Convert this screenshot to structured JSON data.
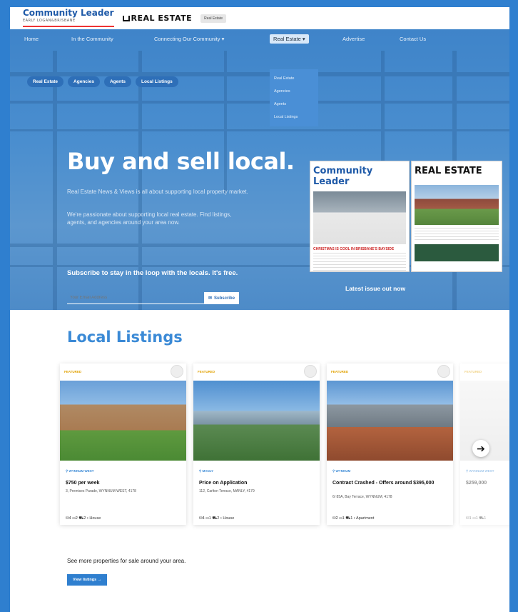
{
  "logos": {
    "community_leader": "Community Leader",
    "community_leader_sub": "EARLY LOGAN&BRISBANE",
    "real_estate": "REAL ESTATE",
    "pill": "Real Estate"
  },
  "nav": {
    "items": [
      "Home",
      "In the Community",
      "Connecting Our Community ▾",
      "Real Estate ▾",
      "Advertise",
      "Contact Us"
    ],
    "dropdown": [
      "Real Estate",
      "Agencies",
      "Agents",
      "Local Listings"
    ],
    "pills": [
      "Real Estate",
      "Agencies",
      "Agents",
      "Local Listings"
    ]
  },
  "hero": {
    "title": "Buy and sell local.",
    "para1": "Real Estate News & Views is all about supporting local property market.",
    "para2": "We're passionate about supporting local real estate. Find listings, agents, and agencies around your area now.",
    "subscribe_title": "Subscribe to stay in the loop with the locals. It's free.",
    "subscribe_placeholder": "Your Email Address",
    "subscribe_button": "Subscribe",
    "latest_issue": "Latest issue out now",
    "mag1_title": "Community Leader",
    "mag1_headline": "CHRISTMAS IS COOL IN BRISBANE'S BAYSIDE",
    "mag2_title": "REAL ESTATE"
  },
  "listings": {
    "title": "Local Listings",
    "cards": [
      {
        "tag": "FEATURED",
        "location": "WYNNUM WEST",
        "price": "$750 per week",
        "address": "3, Premises Parade, WYNNUM WEST, 4178",
        "features": "⛁4  ⛀2  ⛟2  •  House"
      },
      {
        "tag": "FEATURED",
        "location": "MANLY",
        "price": "Price on Application",
        "address": "112, Carlton Terrace, MANLY, 4179",
        "features": "⛁4  ⛀1  ⛟2  •  House"
      },
      {
        "tag": "FEATURED",
        "location": "WYNNUM",
        "price": "Contract Crashed - Offers around $395,000",
        "address": "6/ 85A, Bay Terrace, WYNNUM, 4178",
        "features": "⛁2  ⛀1  ⛟1  •  Apartment"
      },
      {
        "tag": "FEATURED",
        "location": "WYNNUM WEST",
        "price": "$259,000",
        "address": "",
        "features": "⛁1  ⛀1  ⛟1"
      }
    ],
    "see_more": "See more properties for sale around your area.",
    "view_button": "View listings →"
  }
}
